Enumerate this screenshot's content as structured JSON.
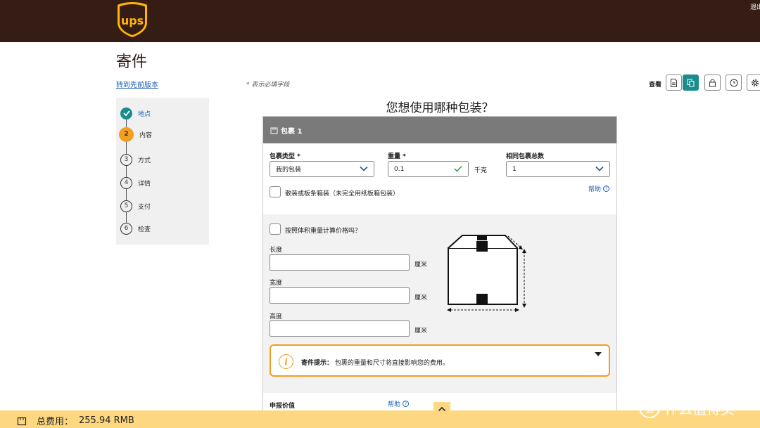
{
  "header": {
    "top_right_link": "退出",
    "brand_colors": {
      "brown": "#351c15",
      "gold": "#ffb500",
      "teal": "#1a8c8c",
      "orange": "#f29d24"
    }
  },
  "page": {
    "title": "寄件",
    "prev_version_link": "转到先前版本",
    "required_note": "* 表示必填字段",
    "view_label": "查看",
    "view_buttons": [
      "document-icon",
      "copy-icon",
      "lock-icon",
      "clock-icon",
      "gear-icon"
    ]
  },
  "steps": [
    {
      "num": "✓",
      "label": "地点",
      "state": "done"
    },
    {
      "num": "2",
      "label": "内容",
      "state": "current"
    },
    {
      "num": "3",
      "label": "方式",
      "state": "todo"
    },
    {
      "num": "4",
      "label": "详情",
      "state": "todo"
    },
    {
      "num": "5",
      "label": "支付",
      "state": "todo"
    },
    {
      "num": "6",
      "label": "检查",
      "state": "todo"
    }
  ],
  "main": {
    "question": "您想使用哪种包装？",
    "package": {
      "title": "包裹 1",
      "type_label": "包裹类型 *",
      "type_value": "我的包装",
      "weight_label": "重量 *",
      "weight_value": "0.1",
      "weight_unit": "千克",
      "count_label": "相同包裹总数",
      "count_value": "1",
      "loose_label": "散装或板条箱装（未完全用纸板箱包装）",
      "help": "帮助",
      "dim_weight_label": "按照体积重量计算价格吗？",
      "length_label": "长度",
      "width_label": "宽度",
      "height_label": "高度",
      "dim_unit": "厘米",
      "tip_title": "寄件提示：",
      "tip_text": "包裹的重量和尺寸将直接影响您的费用。",
      "declared_label": "申报价值",
      "declared_help": "帮助"
    }
  },
  "footer": {
    "cost_label": "总费用：",
    "cost_value": "255.94 RMB"
  },
  "watermark": {
    "icon_text": "值",
    "text": "什么值得买"
  }
}
